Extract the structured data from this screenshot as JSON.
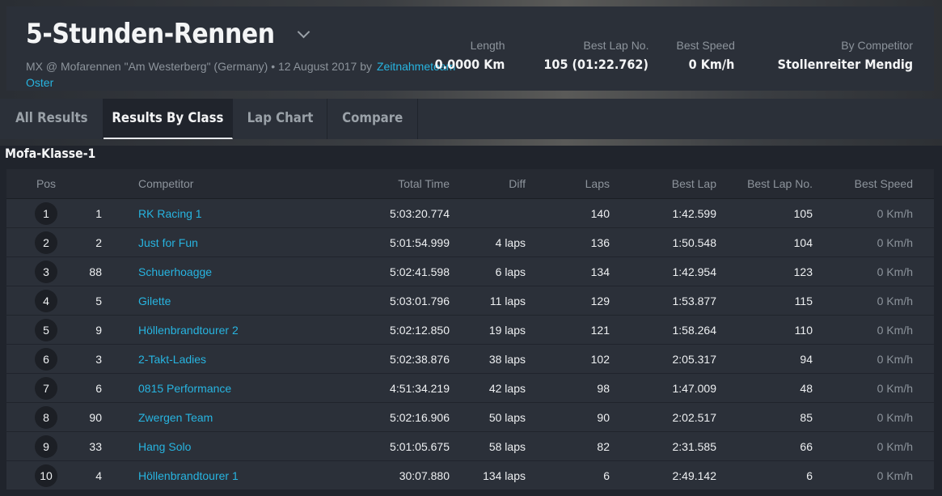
{
  "event": {
    "title": "5-Stunden-Rennen",
    "subtitle_text": "MX @ Mofarennen \"Am Westerberg\" (Germany) • 12 August 2017 by",
    "organizer_link": "Zeitnahmeteam Oster"
  },
  "stats": [
    {
      "label": "Length",
      "value": "0.0000 Km"
    },
    {
      "label": "Best Lap No.",
      "value": "105 (01:22.762)"
    },
    {
      "label": "Best Speed",
      "value": "0 Km/h"
    },
    {
      "label": "By Competitor",
      "value": "Stollenreiter Mendig"
    }
  ],
  "tabs": [
    {
      "label": "All Results",
      "active": false
    },
    {
      "label": "Results By Class",
      "active": true
    },
    {
      "label": "Lap Chart",
      "active": false
    },
    {
      "label": "Compare",
      "active": false
    }
  ],
  "class_name": "Mofa-Klasse-1",
  "table": {
    "headers": {
      "pos": "Pos",
      "competitor": "Competitor",
      "total_time": "Total Time",
      "diff": "Diff",
      "laps": "Laps",
      "best_lap": "Best Lap",
      "best_lap_no": "Best Lap No.",
      "best_speed": "Best Speed"
    },
    "rows": [
      {
        "pos": "1",
        "num": "1",
        "competitor": "RK Racing 1",
        "total": "5:03:20.774",
        "diff": "",
        "laps": "140",
        "best": "1:42.599",
        "best_no": "105",
        "speed": "0 Km/h"
      },
      {
        "pos": "2",
        "num": "2",
        "competitor": "Just for Fun",
        "total": "5:01:54.999",
        "diff": "4 laps",
        "laps": "136",
        "best": "1:50.548",
        "best_no": "104",
        "speed": "0 Km/h"
      },
      {
        "pos": "3",
        "num": "88",
        "competitor": "Schuerhoagge",
        "total": "5:02:41.598",
        "diff": "6 laps",
        "laps": "134",
        "best": "1:42.954",
        "best_no": "123",
        "speed": "0 Km/h"
      },
      {
        "pos": "4",
        "num": "5",
        "competitor": "Gilette",
        "total": "5:03:01.796",
        "diff": "11 laps",
        "laps": "129",
        "best": "1:53.877",
        "best_no": "115",
        "speed": "0 Km/h"
      },
      {
        "pos": "5",
        "num": "9",
        "competitor": "Höllenbrandtourer 2",
        "total": "5:02:12.850",
        "diff": "19 laps",
        "laps": "121",
        "best": "1:58.264",
        "best_no": "110",
        "speed": "0 Km/h"
      },
      {
        "pos": "6",
        "num": "3",
        "competitor": "2-Takt-Ladies",
        "total": "5:02:38.876",
        "diff": "38 laps",
        "laps": "102",
        "best": "2:05.317",
        "best_no": "94",
        "speed": "0 Km/h"
      },
      {
        "pos": "7",
        "num": "6",
        "competitor": "0815 Performance",
        "total": "4:51:34.219",
        "diff": "42 laps",
        "laps": "98",
        "best": "1:47.009",
        "best_no": "48",
        "speed": "0 Km/h"
      },
      {
        "pos": "8",
        "num": "90",
        "competitor": "Zwergen Team",
        "total": "5:02:16.906",
        "diff": "50 laps",
        "laps": "90",
        "best": "2:02.517",
        "best_no": "85",
        "speed": "0 Km/h"
      },
      {
        "pos": "9",
        "num": "33",
        "competitor": "Hang Solo",
        "total": "5:01:05.675",
        "diff": "58 laps",
        "laps": "82",
        "best": "2:31.585",
        "best_no": "66",
        "speed": "0 Km/h"
      },
      {
        "pos": "10",
        "num": "4",
        "competitor": "Höllenbrandtourer 1",
        "total": "30:07.880",
        "diff": "134 laps",
        "laps": "6",
        "best": "2:49.142",
        "best_no": "6",
        "speed": "0 Km/h"
      }
    ]
  },
  "colors": {
    "accent_link": "#27b4e0",
    "background": "#20242c",
    "panel": "#2b3039"
  }
}
